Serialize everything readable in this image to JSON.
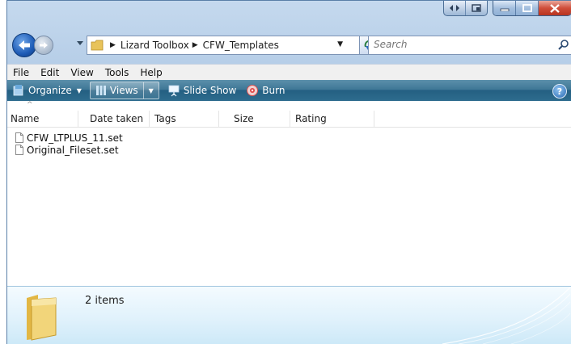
{
  "titlebar": {
    "caption_buttons": [
      "minimize-icon",
      "maximize-icon",
      "close-icon"
    ]
  },
  "address": {
    "crumbs": [
      "Lizard Toolbox",
      "CFW_Templates"
    ]
  },
  "search": {
    "placeholder": "Search"
  },
  "menu": {
    "items": [
      "File",
      "Edit",
      "View",
      "Tools",
      "Help"
    ]
  },
  "toolbar": {
    "organize": "Organize",
    "views": "Views",
    "slideshow": "Slide Show",
    "burn": "Burn"
  },
  "columns": [
    "Name",
    "Date taken",
    "Tags",
    "Size",
    "Rating"
  ],
  "files": [
    {
      "name": "CFW_LTPLUS_11.set"
    },
    {
      "name": "Original_Fileset.set"
    }
  ],
  "details": {
    "count": "2 items"
  },
  "colors": {
    "command_bar": "#3f7796",
    "close_button": "#cf4e3a",
    "nav_back": "#1d5bb6"
  }
}
